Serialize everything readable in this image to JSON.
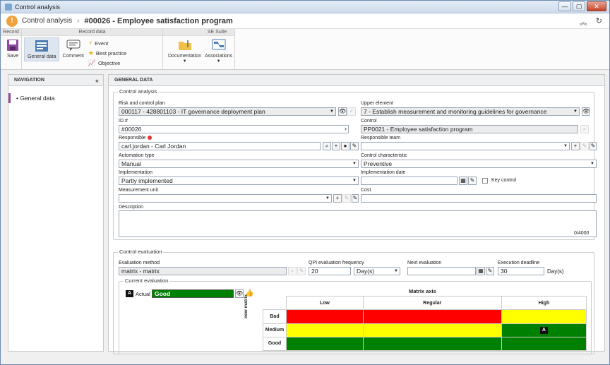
{
  "window": {
    "title": "Control analysis",
    "buttons": [
      "—",
      "▢",
      "✕"
    ]
  },
  "header": {
    "crumb": "Control analysis",
    "title": "#00026 - Employee satisfaction program"
  },
  "ribbon": {
    "groups": [
      {
        "label": "Record"
      },
      {
        "label": "Record data"
      },
      {
        "label": "SE Suite"
      }
    ],
    "save": "Save",
    "general_data": "General data",
    "comment": "Comment",
    "event": "Event",
    "best_practice": "Best practice",
    "objective": "Objective",
    "documentation": "Documentation",
    "associations": "Associations"
  },
  "nav": {
    "title": "NAVIGATION",
    "item": "General data"
  },
  "general": {
    "title": "GENERAL DATA"
  },
  "control_analysis": {
    "legend": "Control analysis",
    "risk_label": "Risk and control plan",
    "risk_value": "000117 - 428801103 - IT governance deployment plan",
    "upper_label": "Upper element",
    "upper_value": "7 - Establish measurement and monitoring guidelines for governance",
    "id_label": "ID #",
    "id_value": "#00026",
    "control_label": "Control",
    "control_value": "PP0021 - Employee satisfaction program",
    "responsible_label": "Responsible",
    "responsible_value": "carl.jordan - Carl Jordan",
    "team_label": "Responsible team",
    "team_value": "",
    "automation_label": "Automation type",
    "automation_value": "Manual",
    "characteristic_label": "Control characteristic",
    "characteristic_value": "Preventive",
    "implementation_label": "Implementation",
    "implementation_value": "Partly implemented",
    "impl_date_label": "Implementation date",
    "impl_date_value": "",
    "key_control": "Key control",
    "measurement_label": "Measurement unit",
    "measurement_value": "",
    "cost_label": "Cost",
    "cost_value": "",
    "description_label": "Description",
    "description_counter": "0/4000"
  },
  "control_evaluation": {
    "legend": "Control evaluation",
    "method_label": "Evaluation method",
    "method_value": "matrix - matrix",
    "qpi_label": "QPI evaluation frequency",
    "qpi_value": "20",
    "qpi_unit": "Day(s)",
    "next_label": "Next evaluation",
    "next_value": "",
    "deadline_label": "Execution deadline",
    "deadline_value": "30",
    "deadline_unit": "Day(s)",
    "current_legend": "Current evaluation",
    "actual_badge": "A",
    "actual_label": "Actual",
    "actual_value": "Good",
    "matrix_title": "Matrix axis",
    "vertical_axis": "new matrix",
    "columns": [
      "Low",
      "Regular",
      "High"
    ],
    "rows": [
      "Bad",
      "Medium",
      "Good"
    ],
    "colors": {
      "red": "#ff0000",
      "yellow": "#ffff00",
      "green": "#008000"
    },
    "marker": "A"
  }
}
